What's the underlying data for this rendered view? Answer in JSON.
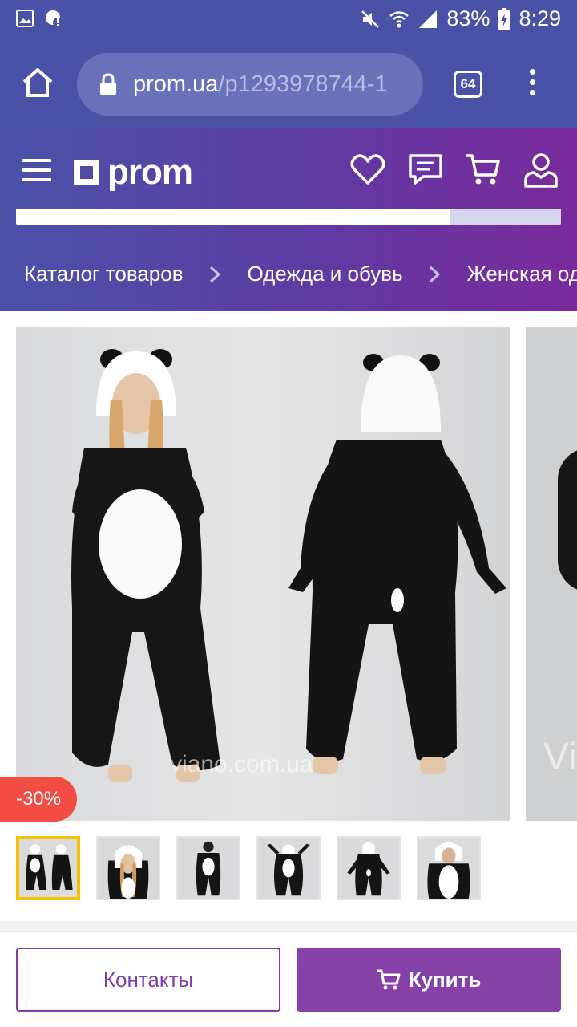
{
  "status_bar": {
    "battery": "83%",
    "time": "8:29"
  },
  "browser": {
    "url_domain": "prom.ua",
    "url_path": "/p1293978744-1",
    "tab_count": "64"
  },
  "header": {
    "logo_text": "prom",
    "breadcrumbs": [
      "Каталог товаров",
      "Одежда и обувь",
      "Женская оде"
    ]
  },
  "gallery": {
    "watermark": "viano.com.ua",
    "watermark_partial": "Vi",
    "discount_badge": "-30%"
  },
  "actions": {
    "contacts_label": "Контакты",
    "buy_label": "Купить"
  },
  "colors": {
    "browser_bar": "#4a52a8",
    "brand_purple": "#8641a8",
    "discount_red": "#f24c43",
    "active_thumb": "#f2c100"
  }
}
